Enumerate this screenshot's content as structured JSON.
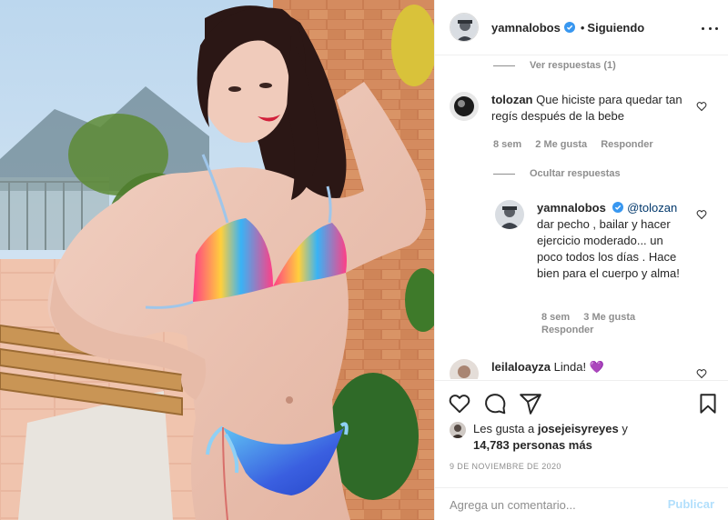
{
  "post": {
    "username": "yamnalobos",
    "dot": "•",
    "follow_status": "Siguiendo"
  },
  "comments": {
    "view_replies": "Ver respuestas (1)",
    "c1": {
      "username": "tolozan",
      "text": "Que hiciste para quedar tan regís después de la bebe",
      "time": "8 sem",
      "likes": "2 Me gusta",
      "reply": "Responder"
    },
    "hide_replies": "Ocultar respuestas",
    "r1": {
      "username": "yamnalobos",
      "mention": "@tolozan",
      "text": "dar pecho , bailar y hacer ejercicio moderado... un poco todos los días . Hace bien para el cuerpo y alma!",
      "time": "8 sem",
      "likes": "3 Me gusta",
      "reply": "Responder"
    },
    "c2": {
      "username": "leilaloayza",
      "text": "Linda!",
      "emoji": "💜"
    }
  },
  "likes": {
    "prefix": "Les gusta a",
    "user": "josejeisyreyes",
    "conj": "y",
    "count": "14,783 personas más"
  },
  "date": "9 DE NOVIEMBRE DE 2020",
  "composer": {
    "placeholder": "Agrega un comentario...",
    "publish": "Publicar"
  },
  "icons": {
    "more": "more-icon",
    "like": "heart-icon",
    "comment": "comment-icon",
    "share": "share-icon",
    "save": "bookmark-icon",
    "verified": "verified-badge-icon"
  },
  "colors": {
    "verified": "#3897f0",
    "link": "#00376b",
    "muted": "#8e8e8e",
    "publish_disabled": "#b2dffc",
    "leila_heart": "#7b3fd6"
  }
}
